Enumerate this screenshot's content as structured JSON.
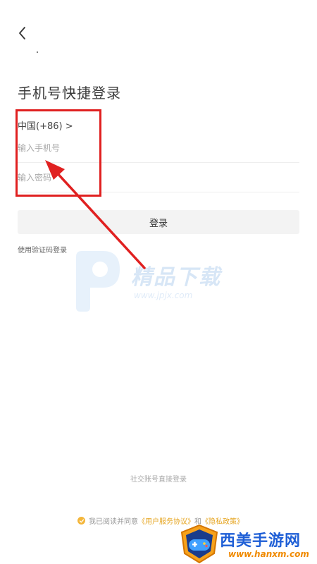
{
  "header": {
    "back_icon": "chevron-left-icon"
  },
  "page": {
    "title": "手机号快捷登录"
  },
  "form": {
    "country_code": "中国(+86) >",
    "phone_placeholder": "输入手机号",
    "password_placeholder": "输入密码",
    "login_label": "登录",
    "sms_login_label": "使用验证码登录"
  },
  "footer": {
    "social_login_label": "社交账号直接登录",
    "agreement_prefix": "我已阅读并同意",
    "user_agreement": "《用户服务协议》",
    "and": "和",
    "privacy_policy": "《隐私政策》"
  },
  "watermarks": {
    "center_brand": "精品下载",
    "center_url": "www.jpjx.com",
    "corner_brand": "西美手游网",
    "corner_url": "www.hanxm.com"
  },
  "colors": {
    "accent": "#e6a520",
    "annotation": "#e02020",
    "button_bg": "#f3f3f3"
  }
}
